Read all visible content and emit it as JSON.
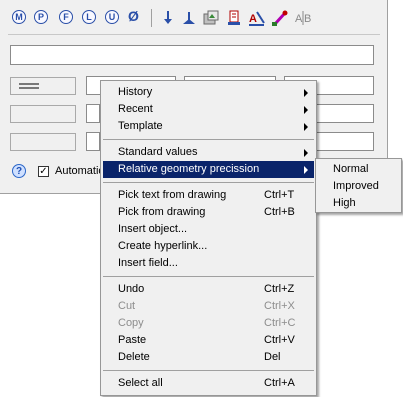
{
  "toolbar": {
    "symbols": [
      "M",
      "P",
      "F",
      "L",
      "U",
      "Ø"
    ]
  },
  "options": {
    "automatic_label": "Automatic"
  },
  "context_menu": {
    "history": "History",
    "recent": "Recent",
    "template": "Template",
    "standard_values": "Standard values",
    "relative_geometry": "Relative geometry precission",
    "pick_text": "Pick text from drawing",
    "pick_text_sc": "Ctrl+T",
    "pick_from": "Pick from drawing",
    "pick_from_sc": "Ctrl+B",
    "insert_object": "Insert object...",
    "create_hyperlink": "Create hyperlink...",
    "insert_field": "Insert field...",
    "undo": "Undo",
    "undo_sc": "Ctrl+Z",
    "cut": "Cut",
    "cut_sc": "Ctrl+X",
    "copy": "Copy",
    "copy_sc": "Ctrl+C",
    "paste": "Paste",
    "paste_sc": "Ctrl+V",
    "delete": "Delete",
    "delete_sc": "Del",
    "select_all": "Select all",
    "select_all_sc": "Ctrl+A"
  },
  "submenu": {
    "normal": "Normal",
    "improved": "Improved",
    "high": "High"
  },
  "colors": {
    "menu_highlight": "#0a246a",
    "toolbar_symbol": "#2a4fa8"
  }
}
